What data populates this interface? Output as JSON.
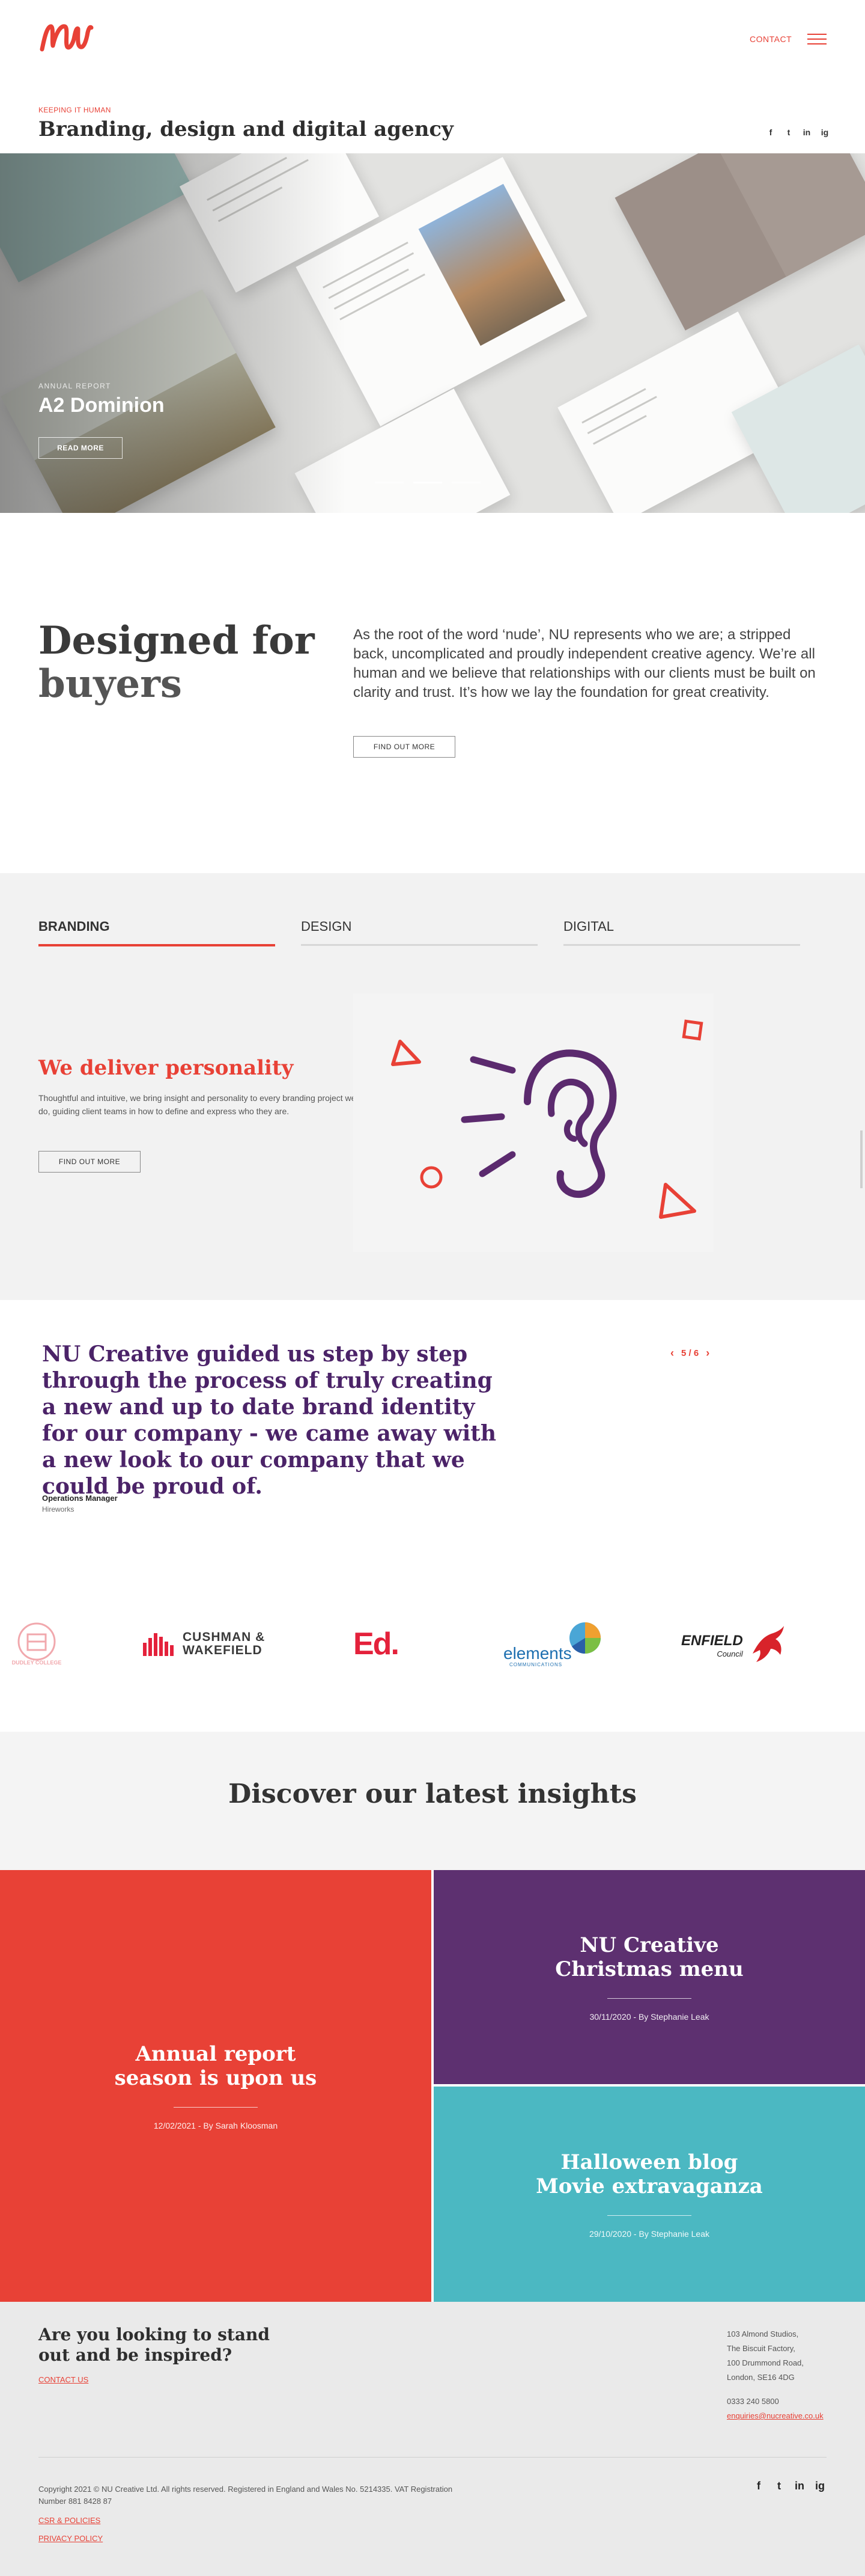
{
  "header": {
    "contact_label": "CONTACT",
    "tagline": "KEEPING IT HUMAN",
    "title": "Branding, design and digital agency",
    "social": [
      "f",
      "t",
      "in",
      "ig"
    ]
  },
  "hero": {
    "kicker": "ANNUAL REPORT",
    "title": "A2 Dominion",
    "button": "READ MORE",
    "slides": 3,
    "active_slide": 2
  },
  "intro": {
    "heading_line1": "Designed for",
    "heading_line2": "buyers",
    "text": "As the root of the word ‘nude’, NU represents who we are; a stripped back, uncomplicated and proudly independent creative agency. We’re all human and we believe that relationships with our clients must be built on clarity and trust. It’s how we lay the foundation for great creativity.",
    "button": "FIND OUT MORE"
  },
  "services": {
    "tabs": [
      {
        "label": "BRANDING",
        "active": true
      },
      {
        "label": "DESIGN",
        "active": false
      },
      {
        "label": "DIGITAL",
        "active": false
      }
    ],
    "title": "We deliver personality",
    "text": "Thoughtful and intuitive, we bring insight and personality to every branding project we do, guiding client teams in how to define and express who they are.",
    "button": "FIND OUT MORE",
    "illustration_icon": "ear-icon",
    "colors": {
      "purple": "#5b2a6e",
      "red": "#e84136"
    }
  },
  "testimonial": {
    "quote": "NU Creative guided us step by step through the process of truly creating a new and up to date brand identity for our company - we came away with a new look to our company that we could be proud of.",
    "name": "Operations Manager",
    "org": "Hireworks",
    "counter": "5 / 6",
    "prev": "‹",
    "next": "›"
  },
  "clients": [
    {
      "name": "DUDLEY COLLEGE",
      "logo": "crest-logo"
    },
    {
      "name": "CUSHMAN & WAKEFIELD",
      "line1": "CUSHMAN &",
      "line2": "WAKEFIELD"
    },
    {
      "name": "Ed.",
      "text": "Ed."
    },
    {
      "name": "elements",
      "text": "elements",
      "sub": "COMMUNICATIONS"
    },
    {
      "name": "ENFIELD Council",
      "line1": "ENFIELD",
      "line2": "Council"
    }
  ],
  "insights": {
    "title": "Discover our latest insights",
    "cards": [
      {
        "title": "Annual report season is upon us",
        "meta": "12/02/2021 - By Sarah Kloosman",
        "color": "#e84136"
      },
      {
        "title": "NU Creative Christmas menu",
        "meta": "30/11/2020 - By Stephanie Leak",
        "color": "#5d3070"
      },
      {
        "title": "Halloween blog Movie extravaganza",
        "meta": "29/10/2020 - By Stephanie Leak",
        "color": "#4bb8c2"
      }
    ]
  },
  "footer": {
    "heading": "Are you looking to stand out and be inspired?",
    "contact_link": "CONTACT US",
    "address": [
      "103 Almond Studios,",
      "The Biscuit Factory,",
      "100 Drummond Road,",
      "London, SE16 4DG"
    ],
    "phone": "0333 240 5800",
    "email": "enquiries@nucreative.co.uk",
    "copyright": "Copyright 2021 © NU Creative Ltd. All rights reserved. Registered in England and Wales No. 5214335. VAT Registration Number 881 8428 87",
    "links": [
      "CSR & POLICIES",
      "PRIVACY POLICY"
    ],
    "social": [
      "f",
      "t",
      "in",
      "ig"
    ]
  }
}
